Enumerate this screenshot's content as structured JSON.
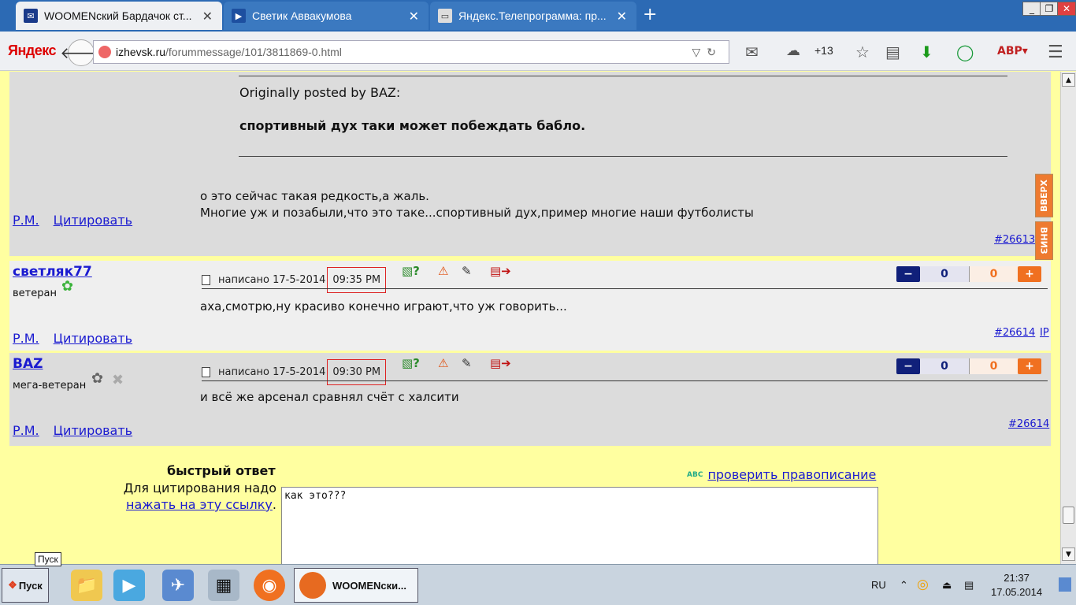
{
  "browser": {
    "tabs": [
      {
        "title": "WOOMENский Бардачок ст...",
        "active": true
      },
      {
        "title": "Светик Аввакумова",
        "active": false
      },
      {
        "title": "Яндекс.Телепрограмма: пр...",
        "active": false
      }
    ],
    "new_tab": "+",
    "brand": "Яндекс",
    "url_host": "izhevsk.ru",
    "url_path": "/forummessage/101/3811869-0.html",
    "weather": "+13",
    "window_controls": {
      "minimize": "_",
      "restore": "❐",
      "close": "✕"
    }
  },
  "quoted_post": {
    "quote_header": "Originally posted by BAZ:",
    "quote_text": "спортивный дух таки может побеждать бабло.",
    "text_line1": "о это сейчас такая редкость,а жаль.",
    "text_line2": "Многие уж и позабыли,что это таке...спортивный дух,пример многие наши футболисты",
    "pm": "Р.М.",
    "quote_link": "Цитировать",
    "post_id": "#26613"
  },
  "side_nav": {
    "up": "ВВЕРХ",
    "down": "ВНИЗ"
  },
  "posts": [
    {
      "author": "светляк77",
      "rank": "ветеран",
      "written_prefix": "написано 17-5-2014",
      "time": "09:35 PM",
      "rating_minus": "−",
      "rating_neg": "0",
      "rating_pos": "0",
      "rating_plus": "+",
      "text": "аха,смотрю,ну красиво конечно играют,что уж говорить...",
      "pm": "Р.М.",
      "quote_link": "Цитировать",
      "post_id": "#26614",
      "ip": "IP"
    },
    {
      "author": "BAZ",
      "rank": "мега-ветеран",
      "written_prefix": "написано 17-5-2014",
      "time": "09:30 PM",
      "rating_minus": "−",
      "rating_neg": "0",
      "rating_pos": "0",
      "rating_plus": "+",
      "text": "и всё же арсенал сравнял счёт с халсити",
      "pm": "Р.М.",
      "quote_link": "Цитировать",
      "post_id": "#26614"
    }
  ],
  "quick_reply": {
    "title": "быстрый ответ",
    "hint": "Для цитирования надо",
    "hint_link": "нажать на эту ссылку",
    "hint_tail": ".",
    "spellcheck": "проверить правописание",
    "spell_icon_text": "ABC",
    "textarea_value": "как это???"
  },
  "taskbar": {
    "start": "Пуск",
    "start_tooltip": "Пуск",
    "active_window": "WOOMENски...",
    "lang": "RU",
    "time": "21:37",
    "date": "17.05.2014"
  }
}
